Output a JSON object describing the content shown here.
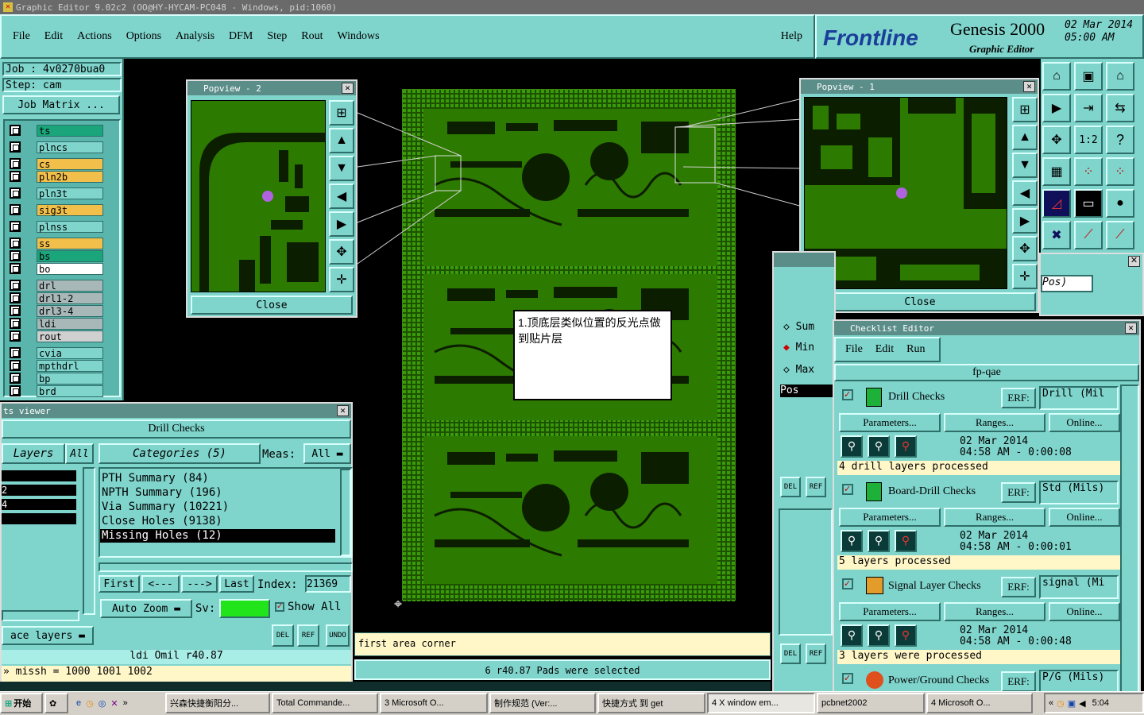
{
  "title_bar": "Graphic Editor 9.02c2 (OO@HY-HYCAM-PC048 - Windows, pid:1060)",
  "menu": [
    "File",
    "Edit",
    "Actions",
    "Options",
    "Analysis",
    "DFM",
    "Step",
    "Rout",
    "Windows"
  ],
  "help": "Help",
  "brand": {
    "logo": "Frontline",
    "product": "Genesis 2000",
    "subtitle": "Graphic Editor",
    "date": "02 Mar 2014",
    "time": "05:00 AM"
  },
  "job": {
    "job": "Job : 4v0270bua0",
    "step": "Step: cam",
    "matrix": "Job Matrix ..."
  },
  "layers": [
    {
      "name": "ts",
      "color": "#1aa57a"
    },
    {
      "name": "plncs",
      "color": "#7fd4cc"
    },
    {
      "name": "cs",
      "color": "#f2c04a"
    },
    {
      "name": "pln2b",
      "color": "#f2c04a"
    },
    {
      "name": "pln3t",
      "color": "#7fd4cc"
    },
    {
      "name": "sig3t",
      "color": "#f2c04a"
    },
    {
      "name": "plnss",
      "color": "#7fd4cc"
    },
    {
      "name": "ss",
      "color": "#f2c04a"
    },
    {
      "name": "bs",
      "color": "#1aa57a"
    },
    {
      "name": "bo",
      "color": "#ffffff"
    },
    {
      "name": "drl",
      "color": "#a8b8b8"
    },
    {
      "name": "drl1-2",
      "color": "#a8b8b8"
    },
    {
      "name": "drl3-4",
      "color": "#a8b8b8"
    },
    {
      "name": "ldi",
      "color": "#a8b8b8"
    },
    {
      "name": "rout",
      "color": "#d0d0d0"
    },
    {
      "name": "cvia",
      "color": "#7fd4cc"
    },
    {
      "name": "mpthdrl",
      "color": "#7fd4cc"
    },
    {
      "name": "bp",
      "color": "#7fd4cc"
    },
    {
      "name": "brd",
      "color": "#7fd4cc"
    }
  ],
  "popview2": {
    "title": "Popview - 2",
    "close": "Close"
  },
  "popview1": {
    "title": "Popview - 1",
    "close": "Close"
  },
  "annotation": "1.顶底层类似位置的反光点做到贴片层",
  "results": {
    "title": "ts viewer",
    "header": "Drill Checks",
    "layers_label": "Layers",
    "all": "All",
    "left_rows": [
      "2",
      "4"
    ],
    "categories": "Categories (5)",
    "meas": "Meas:",
    "meas_val": "All",
    "items": [
      "PTH Summary (84)",
      "NPTH Summary (196)",
      "Via Summary (10221)",
      "Close Holes (9138)",
      "Missing Holes (12)"
    ],
    "first": "First",
    "prev": "<---",
    "next": "--->",
    "last": "Last",
    "index_label": "Index:",
    "index_val": "21369",
    "auto_zoom": "Auto Zoom",
    "sv": "Sv:",
    "show_all": "Show All",
    "ace_layers": "ace layers",
    "del": "DEL",
    "ref": "REF",
    "undo": "UNDO",
    "info": "ldi    Omil     r40.87",
    "cmd": "» missh = 1000 1001 1002"
  },
  "status": {
    "prompt": "first area corner",
    "selected": "6 r40.87 Pads were selected"
  },
  "side_panel": {
    "items": [
      "Sum",
      "Min",
      "Max"
    ],
    "pos": "Pos",
    "pos2": "Pos)",
    "del": "DEL",
    "ref": "REF"
  },
  "checklist": {
    "title": "Checklist Editor",
    "menu": [
      "File",
      "Edit",
      "Run"
    ],
    "name": "fp-qae",
    "params": "Parameters...",
    "ranges": "Ranges...",
    "online": "Online...",
    "erf": "ERF:",
    "checks": [
      {
        "name": "Drill Checks",
        "erf": "Drill (Mil",
        "date": "02 Mar 2014",
        "time": "04:58 AM - 0:00:08",
        "status": "4 drill layers processed",
        "icon_color": "#1db13a"
      },
      {
        "name": "Board-Drill Checks",
        "erf": "Std (Mils)",
        "date": "02 Mar 2014",
        "time": "04:58 AM - 0:00:01",
        "status": "5 layers processed",
        "icon_color": "#1db13a"
      },
      {
        "name": "Signal Layer Checks",
        "erf": "signal (Mi",
        "date": "02 Mar 2014",
        "time": "04:58 AM - 0:00:48",
        "status": "3 layers were processed",
        "icon_color": "#e39b2a"
      },
      {
        "name": "Power/Ground Checks",
        "erf": "P/G (Mils)",
        "date": "",
        "time": "",
        "status": "",
        "icon_color": "#e0501d"
      }
    ]
  },
  "tool_labels": {
    "ratio": "1:2",
    "help": "?"
  },
  "taskbar": {
    "start": "开始",
    "items": [
      "兴森快捷衡阳分...",
      "Total Commande...",
      "3 Microsoft O...",
      "制作规范 (Ver:...",
      "快捷方式 到 get",
      "4 X window em...",
      "pcbnet2002",
      "4 Microsoft O..."
    ],
    "clock": "5:04"
  }
}
